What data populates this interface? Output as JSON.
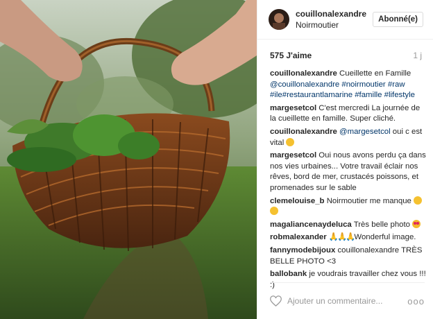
{
  "post": {
    "username": "couillonalexandre",
    "location": "Noirmoutier",
    "follow_label": "Abonné(e)",
    "likes": "575 J'aime",
    "time_ago": "1 j"
  },
  "comments": [
    {
      "user": "couillonalexandre",
      "parts": [
        {
          "t": "Cueillette en Famille "
        },
        {
          "t": "@couillonalexandre",
          "tag": true
        },
        {
          "t": " "
        },
        {
          "t": "#noirmoutier",
          "tag": true
        },
        {
          "t": " "
        },
        {
          "t": "#raw",
          "tag": true
        },
        {
          "t": " "
        },
        {
          "t": "#ile",
          "tag": true
        },
        {
          "t": "#restaurantlamarine",
          "tag": true
        },
        {
          "t": " "
        },
        {
          "t": "#famille",
          "tag": true
        },
        {
          "t": " "
        },
        {
          "t": "#lifestyle",
          "tag": true
        }
      ]
    },
    {
      "user": "margesetcol",
      "parts": [
        {
          "t": "C'est mercredi La journée de la cueillette en famille. Super cliché."
        }
      ]
    },
    {
      "user": "couillonalexandre",
      "parts": [
        {
          "t": "@margesetcol",
          "tag": true
        },
        {
          "t": " oui c est vital "
        },
        {
          "emoji": "smile"
        }
      ]
    },
    {
      "user": "margesetcol",
      "parts": [
        {
          "t": "Oui nous avons perdu ça dans nos vies urbaines... Votre travail éclair nos rêves, bord de mer, crustacés poissons, et promenades sur le sable"
        }
      ]
    },
    {
      "user": "clemelouise_b",
      "parts": [
        {
          "t": "Noirmoutier me manque "
        },
        {
          "emoji": "smile"
        },
        {
          "t": " "
        },
        {
          "emoji": "sad"
        }
      ]
    },
    {
      "user": "magaliancenaydeluca",
      "parts": [
        {
          "t": "Très belle photo "
        },
        {
          "emoji": "heart-eyes"
        }
      ]
    },
    {
      "user": "robmalexander",
      "parts": [
        {
          "emoji": "pray"
        },
        {
          "t": "Wonderful image."
        }
      ]
    },
    {
      "user": "fannymodebijoux",
      "parts": [
        {
          "t": "couillonalexandre TRÈS BELLE PHOTO <3"
        }
      ]
    },
    {
      "user": "ballobank",
      "parts": [
        {
          "t": "je voudrais travailler chez vous !!! :)"
        }
      ]
    }
  ],
  "footer": {
    "add_comment_placeholder": "Ajouter un commentaire...",
    "more_label": "ooo"
  },
  "icons": {
    "heart": "heart-outline-icon",
    "more": "more-options-icon"
  }
}
